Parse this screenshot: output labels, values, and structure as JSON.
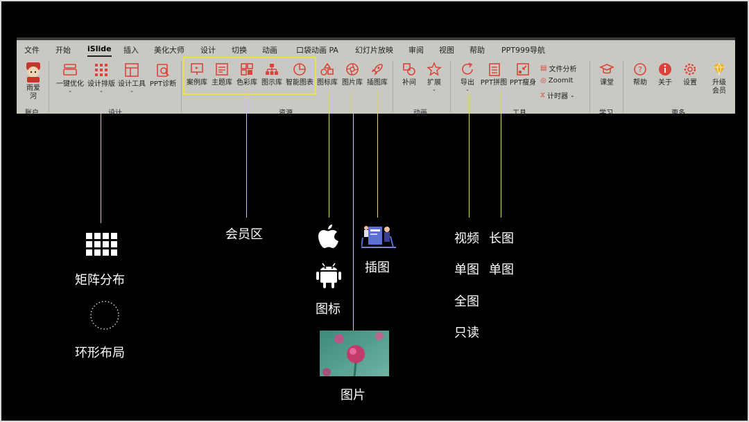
{
  "tabs": [
    "文件",
    "开始",
    "iSlide",
    "插入",
    "美化大师",
    "设计",
    "切换",
    "动画",
    "口袋动画 PA",
    "幻灯片放映",
    "审阅",
    "视图",
    "帮助",
    "PPT999导航"
  ],
  "active_tab": "iSlide",
  "account": {
    "user_label_1": "雨爱",
    "user_label_2": "河",
    "group": "账户"
  },
  "design": {
    "btn_optimize": "一键优化",
    "btn_layout": "设计排版",
    "btn_tools": "设计工具",
    "btn_diagnose": "PPT诊断",
    "group": "设计"
  },
  "resources": {
    "btn_cases": "案例库",
    "btn_themes": "主题库",
    "btn_colors": "色彩库",
    "btn_diagrams": "图示库",
    "btn_charts": "智能图表",
    "btn_icons": "图标库",
    "btn_images": "图片库",
    "btn_illus": "插图库",
    "group": "资源"
  },
  "animation": {
    "btn_tween": "补间",
    "btn_extend": "扩展",
    "group": "动画"
  },
  "tools": {
    "btn_export": "导出",
    "btn_stitch": "PPT拼图",
    "btn_slim": "PPT瘦身",
    "file_analysis": "文件分析",
    "zoomit": "ZoomIt",
    "timer": "计时器",
    "group": "工具"
  },
  "learn": {
    "btn_class": "课堂",
    "group": "学习"
  },
  "more": {
    "btn_help": "帮助",
    "btn_about": "关于",
    "btn_settings": "设置",
    "btn_upgrade_1": "升级",
    "btn_upgrade_2": "会员",
    "group": "更多"
  },
  "annotations": {
    "matrix": "矩阵分布",
    "ring": "环形布局",
    "member": "会员区",
    "icons": "图标",
    "illus": "插图",
    "picture": "图片",
    "video": "视频",
    "long_image": "长图",
    "single_1": "单图",
    "single_2": "单图",
    "full": "全图",
    "readonly": "只读"
  },
  "colors": {
    "ribbon_bg": "#c9c8c2",
    "accent_red": "#d9453c",
    "highlight": "#e9e14b",
    "gold": "#e8b21c"
  }
}
